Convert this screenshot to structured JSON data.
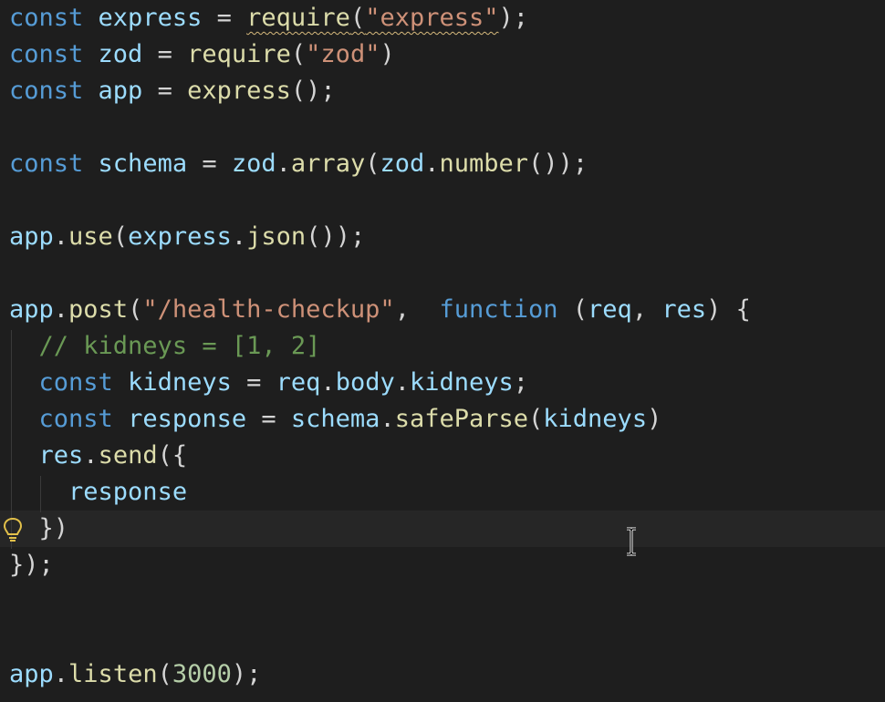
{
  "editor": {
    "language": "javascript",
    "lines": [
      [
        [
          "kw",
          "const"
        ],
        [
          "pun",
          " "
        ],
        [
          "var",
          "express"
        ],
        [
          "pun",
          " = "
        ],
        [
          "fn",
          "require",
          "sq"
        ],
        [
          "pun",
          "(",
          "sq"
        ],
        [
          "str",
          "\"express\"",
          "sq"
        ],
        [
          "pun",
          ")"
        ],
        [
          "pun",
          ";"
        ]
      ],
      [
        [
          "kw",
          "const"
        ],
        [
          "pun",
          " "
        ],
        [
          "var",
          "zod"
        ],
        [
          "pun",
          " = "
        ],
        [
          "fn",
          "require"
        ],
        [
          "pun",
          "("
        ],
        [
          "str",
          "\"zod\""
        ],
        [
          "pun",
          ")"
        ]
      ],
      [
        [
          "kw",
          "const"
        ],
        [
          "pun",
          " "
        ],
        [
          "var",
          "app"
        ],
        [
          "pun",
          " = "
        ],
        [
          "fn",
          "express"
        ],
        [
          "pun",
          "();"
        ]
      ],
      [],
      [
        [
          "kw",
          "const"
        ],
        [
          "pun",
          " "
        ],
        [
          "var",
          "schema"
        ],
        [
          "pun",
          " = "
        ],
        [
          "var",
          "zod"
        ],
        [
          "pun",
          "."
        ],
        [
          "fn",
          "array"
        ],
        [
          "pun",
          "("
        ],
        [
          "var",
          "zod"
        ],
        [
          "pun",
          "."
        ],
        [
          "fn",
          "number"
        ],
        [
          "pun",
          "());"
        ]
      ],
      [],
      [
        [
          "var",
          "app"
        ],
        [
          "pun",
          "."
        ],
        [
          "fn",
          "use"
        ],
        [
          "pun",
          "("
        ],
        [
          "var",
          "express"
        ],
        [
          "pun",
          "."
        ],
        [
          "fn",
          "json"
        ],
        [
          "pun",
          "());"
        ]
      ],
      [],
      [
        [
          "var",
          "app"
        ],
        [
          "pun",
          "."
        ],
        [
          "fn",
          "post"
        ],
        [
          "pun",
          "("
        ],
        [
          "str",
          "\"/health-checkup\""
        ],
        [
          "pun",
          ",  "
        ],
        [
          "kw",
          "function"
        ],
        [
          "pun",
          " ("
        ],
        [
          "var",
          "req"
        ],
        [
          "pun",
          ", "
        ],
        [
          "var",
          "res"
        ],
        [
          "pun",
          ") {"
        ]
      ],
      [
        [
          "pun",
          "  "
        ],
        [
          "cmt",
          "// kidneys = [1, 2]"
        ]
      ],
      [
        [
          "pun",
          "  "
        ],
        [
          "kw",
          "const"
        ],
        [
          "pun",
          " "
        ],
        [
          "var",
          "kidneys"
        ],
        [
          "pun",
          " = "
        ],
        [
          "var",
          "req"
        ],
        [
          "pun",
          "."
        ],
        [
          "prop",
          "body"
        ],
        [
          "pun",
          "."
        ],
        [
          "prop",
          "kidneys"
        ],
        [
          "pun",
          ";"
        ]
      ],
      [
        [
          "pun",
          "  "
        ],
        [
          "kw",
          "const"
        ],
        [
          "pun",
          " "
        ],
        [
          "var",
          "response"
        ],
        [
          "pun",
          " = "
        ],
        [
          "var",
          "schema"
        ],
        [
          "pun",
          "."
        ],
        [
          "fn",
          "safeParse"
        ],
        [
          "pun",
          "("
        ],
        [
          "var",
          "kidneys"
        ],
        [
          "pun",
          ")"
        ]
      ],
      [
        [
          "pun",
          "  "
        ],
        [
          "var",
          "res"
        ],
        [
          "pun",
          "."
        ],
        [
          "fn",
          "send"
        ],
        [
          "pun",
          "({"
        ]
      ],
      [
        [
          "pun",
          "    "
        ],
        [
          "prop",
          "response"
        ]
      ],
      [
        [
          "pun",
          "  "
        ],
        [
          "pun",
          "})"
        ]
      ],
      [
        [
          "pun",
          "});"
        ]
      ],
      [],
      [],
      [
        [
          "var",
          "app"
        ],
        [
          "pun",
          "."
        ],
        [
          "fn",
          "listen"
        ],
        [
          "pun",
          "("
        ],
        [
          "num",
          "3000"
        ],
        [
          "pun",
          ");"
        ]
      ]
    ],
    "active_line": 14,
    "lightbulb": "lightbulb-icon",
    "cursor": "text-cursor-icon",
    "colors": {
      "background": "#1e1e1e",
      "keyword": "#569cd6",
      "variable": "#9cdcfe",
      "function": "#dcdcaa",
      "string": "#ce9178",
      "number": "#b5cea8",
      "comment": "#6a9955"
    }
  }
}
